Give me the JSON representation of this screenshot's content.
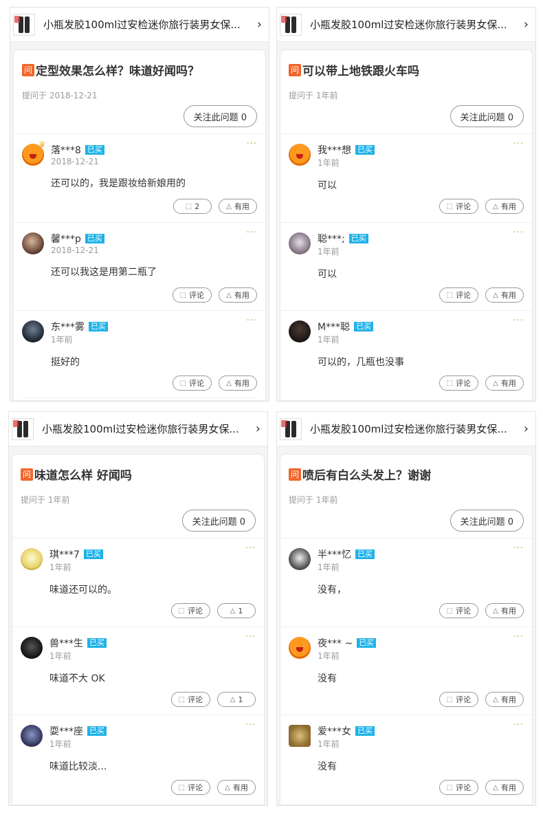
{
  "panels": [
    {
      "header_title": "小瓶发胶100ml过安检迷你旅行装男女保...",
      "question": "定型效果怎么样？味道好闻吗？",
      "asked": "提问于 2018-12-21",
      "follow": "关注此问题 0",
      "answers": [
        {
          "name": "落***8",
          "badge": "已买",
          "date": "2018-12-21",
          "text": "还可以的，我是跟妆给新娘用的",
          "comment": "2",
          "useful": "有用",
          "avatar": "orange-avatar"
        },
        {
          "name": "馨***p",
          "badge": "已买",
          "date": "2018-12-21",
          "text": "还可以我这是用第二瓶了",
          "comment": "评论",
          "useful": "有用",
          "avatar": "photo-avatar"
        },
        {
          "name": "东***雾",
          "badge": "已买",
          "date": "1年前",
          "text": "挺好的",
          "comment": "评论",
          "useful": "有用",
          "avatar": "photo-avatar"
        }
      ]
    },
    {
      "header_title": "小瓶发胶100ml过安检迷你旅行装男女保...",
      "question": "可以带上地铁跟火车吗",
      "asked": "提问于 1年前",
      "follow": "关注此问题 0",
      "answers": [
        {
          "name": "我***想",
          "badge": "已买",
          "date": "1年前",
          "text": "可以",
          "comment": "评论",
          "useful": "有用",
          "avatar": "orange-avatar"
        },
        {
          "name": "聪***;",
          "badge": "已买",
          "date": "1年前",
          "text": "可以",
          "comment": "评论",
          "useful": "有用",
          "avatar": "photo-avatar"
        },
        {
          "name": "M***聪",
          "badge": "已买",
          "date": "1年前",
          "text": "可以的，几瓶也没事",
          "comment": "评论",
          "useful": "有用",
          "avatar": "photo-avatar"
        }
      ]
    },
    {
      "header_title": "小瓶发胶100ml过安检迷你旅行装男女保...",
      "question": "味道怎么样  好闻吗",
      "asked": "提问于 1年前",
      "follow": "关注此问题 0",
      "answers": [
        {
          "name": "琪***7",
          "badge": "已买",
          "date": "1年前",
          "text": "味道还可以的。",
          "comment": "评论",
          "useful": "1",
          "avatar": "photo-avatar"
        },
        {
          "name": "兽***生",
          "badge": "已买",
          "date": "1年前",
          "text": "味道不大   OK",
          "comment": "评论",
          "useful": "1",
          "avatar": "photo-avatar"
        },
        {
          "name": "耍***座",
          "badge": "已买",
          "date": "1年前",
          "text": "味道比较淡...",
          "comment": "评论",
          "useful": "有用",
          "avatar": "photo-avatar"
        }
      ]
    },
    {
      "header_title": "小瓶发胶100ml过安检迷你旅行装男女保...",
      "question": "喷后有白么头发上？谢谢",
      "asked": "提问于 1年前",
      "follow": "关注此问题 0",
      "answers": [
        {
          "name": "半***忆",
          "badge": "已买",
          "date": "1年前",
          "text": "没有，",
          "comment": "评论",
          "useful": "有用",
          "avatar": "photo-avatar"
        },
        {
          "name": "夜*** ~",
          "badge": "已买",
          "date": "1年前",
          "text": "没有",
          "comment": "评论",
          "useful": "有用",
          "avatar": "orange-avatar"
        },
        {
          "name": "爱***女",
          "badge": "已买",
          "date": "1年前",
          "text": "没有",
          "comment": "评论",
          "useful": "有用",
          "avatar": "photo-avatar"
        }
      ]
    }
  ],
  "icons": {
    "question": "问",
    "chevron": "›",
    "more": "···",
    "comment": "comment-icon",
    "thumb_up": "triangle-up-icon"
  }
}
